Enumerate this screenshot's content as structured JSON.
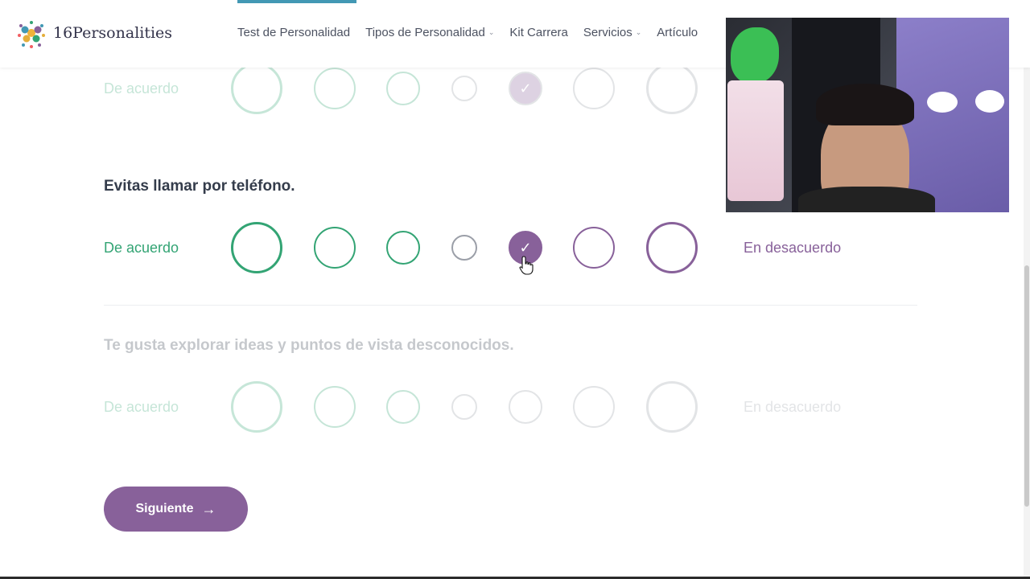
{
  "brand": {
    "logo_text": "16Personalities"
  },
  "nav": {
    "items": [
      {
        "label": "Test de Personalidad",
        "has_dropdown": false,
        "active": true
      },
      {
        "label": "Tipos de Personalidad",
        "has_dropdown": true
      },
      {
        "label": "Kit Carrera",
        "has_dropdown": false
      },
      {
        "label": "Servicios",
        "has_dropdown": true
      },
      {
        "label": "Artículo",
        "has_dropdown": false
      }
    ]
  },
  "questions": [
    {
      "title": "",
      "agree": "De acuerdo",
      "disagree": "",
      "selected_index": 4,
      "state": "answered-faded"
    },
    {
      "title": "Evitas llamar por teléfono.",
      "agree": "De acuerdo",
      "disagree": "En desacuerdo",
      "selected_index": 4,
      "state": "active"
    },
    {
      "title": "Te gusta explorar ideas y puntos de vista desconocidos.",
      "agree": "De acuerdo",
      "disagree": "En desacuerdo",
      "selected_index": null,
      "state": "upcoming-faded"
    }
  ],
  "next_button": {
    "label": "Siguiente"
  },
  "icons": {
    "checkmark": "check-icon",
    "arrow": "arrow-right-icon",
    "chevron": "chevron-down-icon"
  },
  "colors": {
    "agree": "#33a474",
    "disagree": "#88619a",
    "neutral": "#9b9fa8",
    "accent": "#4298b4"
  },
  "webcam": {
    "present": true
  }
}
